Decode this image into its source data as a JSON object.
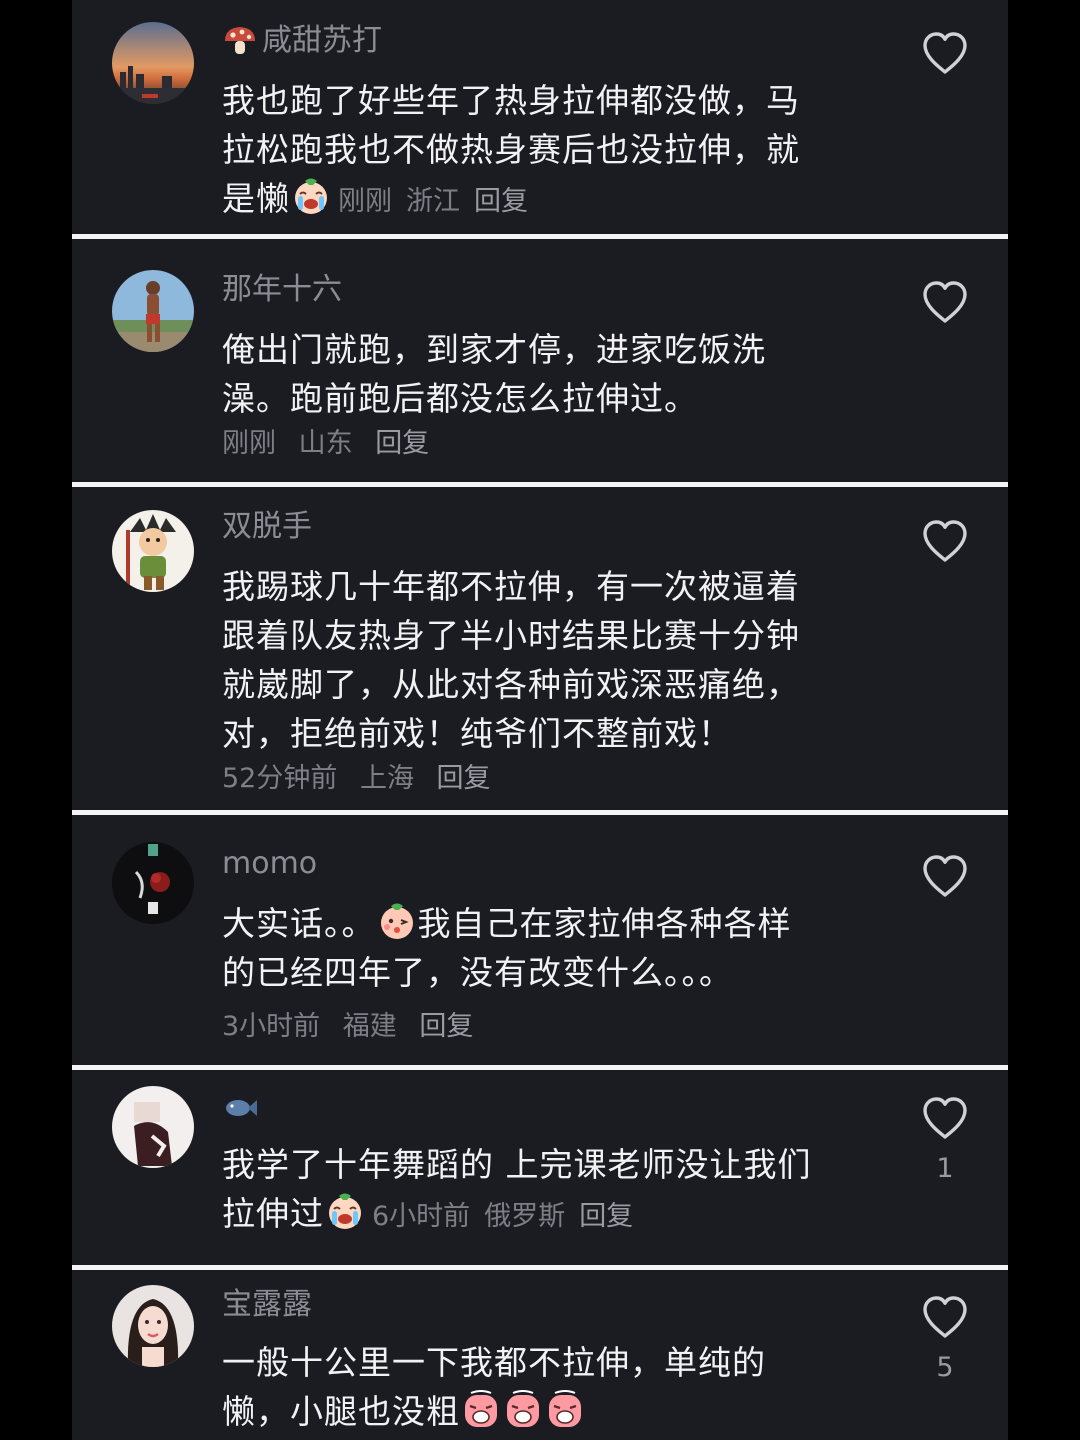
{
  "colors": {
    "page_background": "#000000",
    "card_background": "#1b1b22",
    "separator": "#f4f4f6",
    "username": "#8c8c94",
    "comment_text": "#f2f2f4",
    "meta_text": "#7e7e86"
  },
  "comments": [
    {
      "username": "咸甜苏打",
      "username_icon": "mushroom-icon",
      "avatar": "sunset-city-avatar",
      "lines": [
        "我也跑了好些年了热身拉伸都没做，马",
        "拉松跑我也不做热身赛后也没拉伸，就",
        "是懒"
      ],
      "emoji": "crying-face-emoji",
      "time": "刚刚",
      "location": "浙江",
      "reply_label": "回复",
      "like_icon": "heart-outline-icon",
      "like_count": ""
    },
    {
      "username": "那年十六",
      "avatar": "runner-avatar",
      "lines": [
        "俺出门就跑，到家才停，进家吃饭洗",
        "澡。跑前跑后都没怎么拉伸过。"
      ],
      "time": "刚刚",
      "location": "山东",
      "reply_label": "回复",
      "like_icon": "heart-outline-icon",
      "like_count": ""
    },
    {
      "username": "双脱手",
      "avatar": "cartoon-warrior-avatar",
      "lines": [
        "我踢球几十年都不拉伸，有一次被逼着",
        "跟着队友热身了半小时结果比赛十分钟",
        "就崴脚了，从此对各种前戏深恶痛绝，",
        "对，拒绝前戏！纯爷们不整前戏！"
      ],
      "time": "52分钟前",
      "location": "上海",
      "reply_label": "回复",
      "like_icon": "heart-outline-icon",
      "like_count": ""
    },
    {
      "username": "momo",
      "avatar": "dark-rose-avatar",
      "lines": [
        "大实话。。",
        "我自己在家拉伸各种各样",
        "的已经四年了，没有改变什么。。。"
      ],
      "emoji": "blowing-kiss-emoji",
      "time": "3小时前",
      "location": "福建",
      "reply_label": "回复",
      "like_icon": "heart-outline-icon",
      "like_count": ""
    },
    {
      "username": "",
      "username_icon": "fish-icon",
      "avatar": "blurred-photo-avatar",
      "lines": [
        "我学了十年舞蹈的 上完课老师没让我们",
        "拉伸过"
      ],
      "emoji": "crying-face-emoji",
      "time": "6小时前",
      "location": "俄罗斯",
      "reply_label": "回复",
      "like_icon": "heart-outline-icon",
      "like_count": "1"
    },
    {
      "username": "宝露露",
      "avatar": "woman-portrait-avatar",
      "lines": [
        "一般十公里一下我都不拉伸，单纯的",
        "懒，小腿也没粗"
      ],
      "emoji": "wailing-face-emoji",
      "time": "",
      "location": "",
      "reply_label": "",
      "like_icon": "heart-outline-icon",
      "like_count": "5"
    }
  ]
}
